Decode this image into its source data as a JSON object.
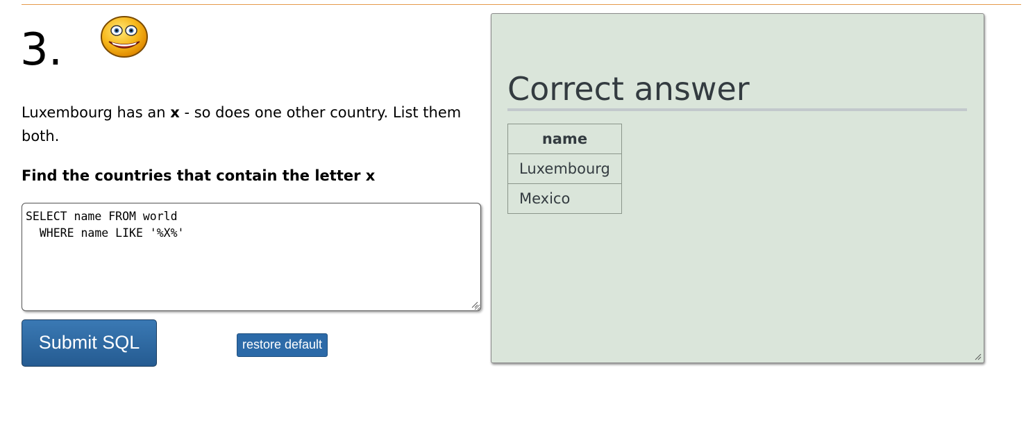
{
  "question": {
    "number": "3.",
    "text_before": "Luxembourg has an ",
    "text_bold": "x",
    "text_after": " - so does one other country. List them both.",
    "task": "Find the countries that contain the letter x",
    "icon": "smiley-face-icon"
  },
  "editor": {
    "value": "SELECT name FROM world\n  WHERE name LIKE '%X%'"
  },
  "buttons": {
    "submit_label": "Submit SQL",
    "restore_label": "restore default"
  },
  "answer": {
    "title": "Correct answer",
    "column_header": "name",
    "rows": [
      "Luxembourg",
      "Mexico"
    ]
  },
  "colors": {
    "panel_background": "#dae5da",
    "button_blue": "#2c6aa8",
    "rule_orange": "#e59a4a"
  }
}
